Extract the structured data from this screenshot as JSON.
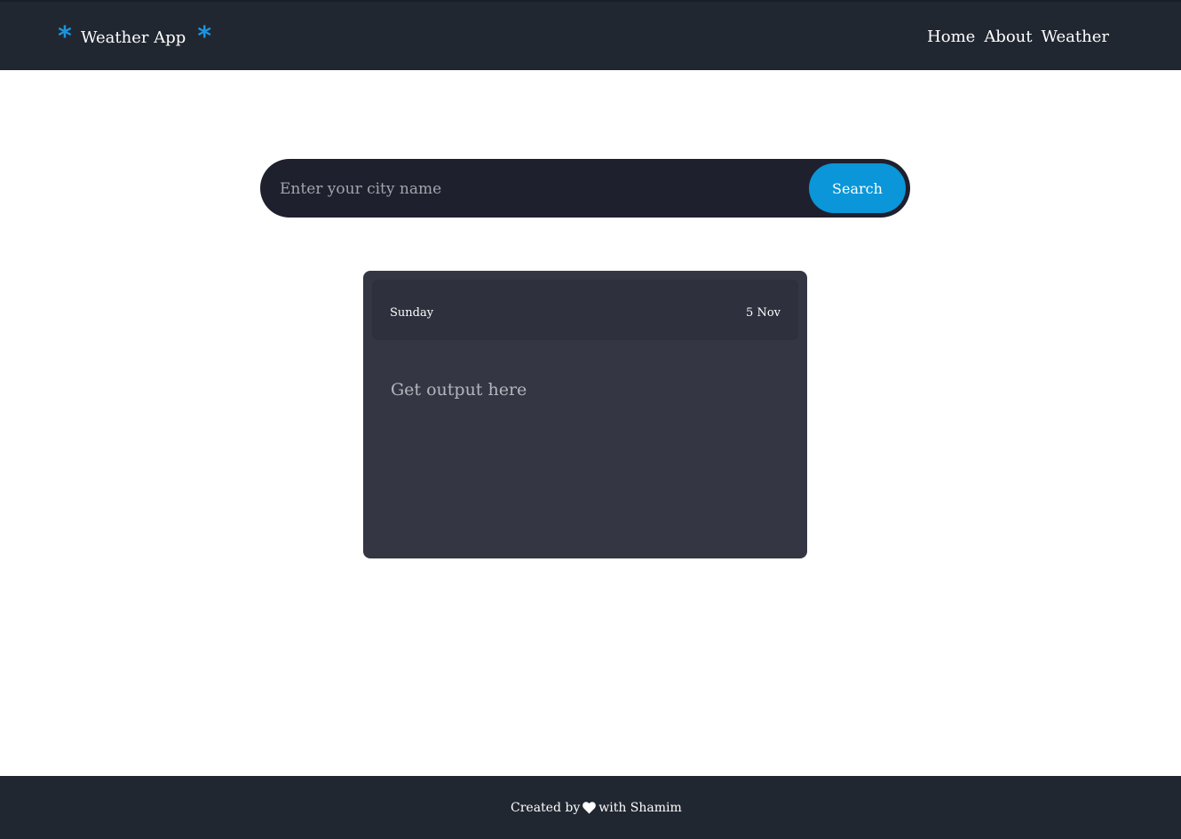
{
  "header": {
    "brand_title": "Weather App",
    "brand_icon": "asterisk-icon",
    "accent_color": "#1a95dc",
    "nav": [
      {
        "label": "Home"
      },
      {
        "label": "About"
      },
      {
        "label": "Weather"
      }
    ]
  },
  "search": {
    "placeholder": "Enter your city name",
    "value": "",
    "button_label": "Search",
    "button_color": "#0a96d8"
  },
  "card": {
    "day": "Sunday",
    "date": "5 Nov",
    "output_text": "Get output here"
  },
  "footer": {
    "prefix": "Created by",
    "heart_icon": "heart-icon",
    "suffix": "with Shamim"
  }
}
